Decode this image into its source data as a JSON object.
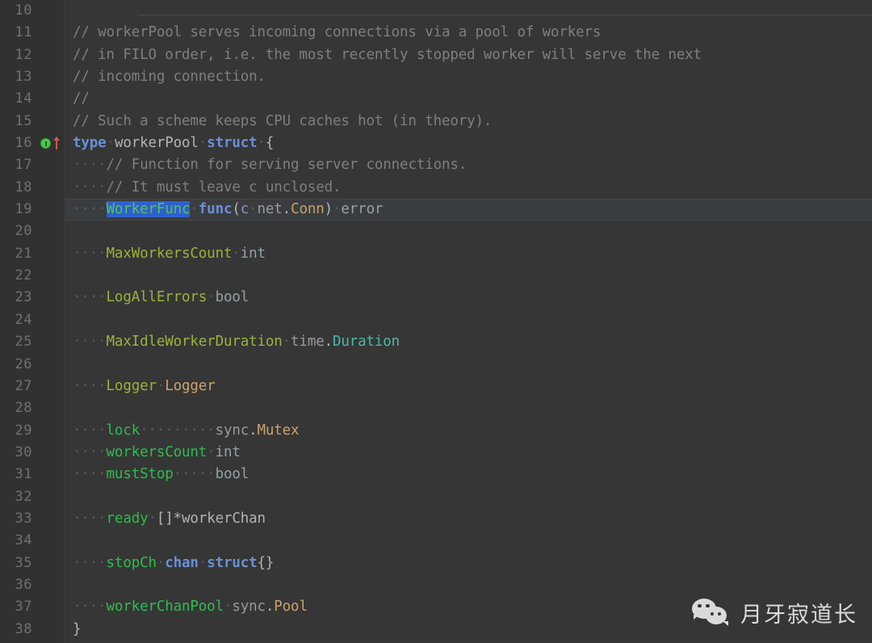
{
  "editor": {
    "language": "Go",
    "first_visible_line": 10,
    "last_visible_line": 38,
    "current_line": 19,
    "selected_text": "WorkerFunc",
    "background_color": "#363636",
    "gutter_color": "#313131",
    "current_line_color": "#3a3d3f",
    "selection_color": "#2f5fd0"
  },
  "gutter": {
    "line_numbers": [
      "10",
      "11",
      "12",
      "13",
      "14",
      "15",
      "16",
      "17",
      "18",
      "19",
      "20",
      "21",
      "22",
      "23",
      "24",
      "25",
      "26",
      "27",
      "28",
      "29",
      "30",
      "31",
      "32",
      "33",
      "34",
      "35",
      "36",
      "37",
      "38"
    ],
    "markers": [
      {
        "line": "16",
        "icons": [
          "interface-implemented-icon",
          "overridden-up-arrow-icon"
        ]
      }
    ]
  },
  "code_lines": [
    {
      "number": "10",
      "text": "",
      "tokens": []
    },
    {
      "number": "11",
      "text": "// workerPool serves incoming connections via a pool of workers",
      "tokens": [
        {
          "t": "// workerPool serves incoming connections via a pool of workers",
          "c": "comment"
        }
      ]
    },
    {
      "number": "12",
      "text": "// in FILO order, i.e. the most recently stopped worker will serve the next",
      "tokens": [
        {
          "t": "// in FILO order, i.e. the most recently stopped worker will serve the next",
          "c": "comment"
        }
      ]
    },
    {
      "number": "13",
      "text": "// incoming connection.",
      "tokens": [
        {
          "t": "// incoming connection.",
          "c": "comment"
        }
      ]
    },
    {
      "number": "14",
      "text": "//",
      "tokens": [
        {
          "t": "//",
          "c": "comment"
        }
      ]
    },
    {
      "number": "15",
      "text": "// Such a scheme keeps CPU caches hot (in theory).",
      "tokens": [
        {
          "t": "// Such a scheme keeps CPU caches hot (in theory).",
          "c": "comment"
        }
      ]
    },
    {
      "number": "16",
      "text": "type workerPool struct {",
      "tokens": [
        {
          "t": "type",
          "c": "kw"
        },
        {
          "t": " ",
          "c": "ws"
        },
        {
          "t": "workerPool",
          "c": "plain"
        },
        {
          "t": " ",
          "c": "ws"
        },
        {
          "t": "struct",
          "c": "kw"
        },
        {
          "t": " ",
          "c": "ws"
        },
        {
          "t": "{",
          "c": "plain"
        }
      ]
    },
    {
      "number": "17",
      "text": "    // Function for serving server connections.",
      "tokens": [
        {
          "t": "    ",
          "c": "ws"
        },
        {
          "t": "// Function for serving server connections.",
          "c": "comment"
        }
      ]
    },
    {
      "number": "18",
      "text": "    // It must leave c unclosed.",
      "tokens": [
        {
          "t": "    ",
          "c": "ws"
        },
        {
          "t": "// It must leave c unclosed.",
          "c": "comment"
        }
      ]
    },
    {
      "number": "19",
      "text": "    WorkerFunc func(c net.Conn) error",
      "tokens": [
        {
          "t": "    ",
          "c": "ws"
        },
        {
          "t": "WorkerFunc",
          "c": "sel"
        },
        {
          "t": " ",
          "c": "ws"
        },
        {
          "t": "func",
          "c": "kw"
        },
        {
          "t": "(",
          "c": "plain"
        },
        {
          "t": "c",
          "c": "param"
        },
        {
          "t": " ",
          "c": "ws"
        },
        {
          "t": "net",
          "c": "pkg"
        },
        {
          "t": ".",
          "c": "plain"
        },
        {
          "t": "Conn",
          "c": "type3"
        },
        {
          "t": ")",
          "c": "plain"
        },
        {
          "t": " ",
          "c": "ws"
        },
        {
          "t": "error",
          "c": "type"
        }
      ]
    },
    {
      "number": "20",
      "text": "",
      "tokens": []
    },
    {
      "number": "21",
      "text": "    MaxWorkersCount int",
      "tokens": [
        {
          "t": "    ",
          "c": "ws"
        },
        {
          "t": "MaxWorkersCount",
          "c": "field-pub"
        },
        {
          "t": " ",
          "c": "ws"
        },
        {
          "t": "int",
          "c": "type"
        }
      ]
    },
    {
      "number": "22",
      "text": "",
      "tokens": []
    },
    {
      "number": "23",
      "text": "    LogAllErrors bool",
      "tokens": [
        {
          "t": "    ",
          "c": "ws"
        },
        {
          "t": "LogAllErrors",
          "c": "field-pub"
        },
        {
          "t": " ",
          "c": "ws"
        },
        {
          "t": "bool",
          "c": "type"
        }
      ]
    },
    {
      "number": "24",
      "text": "",
      "tokens": []
    },
    {
      "number": "25",
      "text": "    MaxIdleWorkerDuration time.Duration",
      "tokens": [
        {
          "t": "    ",
          "c": "ws"
        },
        {
          "t": "MaxIdleWorkerDuration",
          "c": "field-pub"
        },
        {
          "t": " ",
          "c": "ws"
        },
        {
          "t": "time",
          "c": "pkg"
        },
        {
          "t": ".",
          "c": "plain"
        },
        {
          "t": "Duration",
          "c": "type2"
        }
      ]
    },
    {
      "number": "26",
      "text": "",
      "tokens": []
    },
    {
      "number": "27",
      "text": "    Logger Logger",
      "tokens": [
        {
          "t": "    ",
          "c": "ws"
        },
        {
          "t": "Logger",
          "c": "field-pub"
        },
        {
          "t": " ",
          "c": "ws"
        },
        {
          "t": "Logger",
          "c": "type3"
        }
      ]
    },
    {
      "number": "28",
      "text": "",
      "tokens": []
    },
    {
      "number": "29",
      "text": "    lock         sync.Mutex",
      "tokens": [
        {
          "t": "    ",
          "c": "ws"
        },
        {
          "t": "lock",
          "c": "field"
        },
        {
          "t": "         ",
          "c": "ws"
        },
        {
          "t": "sync",
          "c": "pkg"
        },
        {
          "t": ".",
          "c": "plain"
        },
        {
          "t": "Mutex",
          "c": "type3"
        }
      ]
    },
    {
      "number": "30",
      "text": "    workersCount int",
      "tokens": [
        {
          "t": "    ",
          "c": "ws"
        },
        {
          "t": "workersCount",
          "c": "field"
        },
        {
          "t": " ",
          "c": "ws"
        },
        {
          "t": "int",
          "c": "type"
        }
      ]
    },
    {
      "number": "31",
      "text": "    mustStop     bool",
      "tokens": [
        {
          "t": "    ",
          "c": "ws"
        },
        {
          "t": "mustStop",
          "c": "field"
        },
        {
          "t": "     ",
          "c": "ws"
        },
        {
          "t": "bool",
          "c": "type"
        }
      ]
    },
    {
      "number": "32",
      "text": "",
      "tokens": []
    },
    {
      "number": "33",
      "text": "    ready []*workerChan",
      "tokens": [
        {
          "t": "    ",
          "c": "ws"
        },
        {
          "t": "ready",
          "c": "field"
        },
        {
          "t": " ",
          "c": "ws"
        },
        {
          "t": "[]*workerChan",
          "c": "plain"
        }
      ]
    },
    {
      "number": "34",
      "text": "",
      "tokens": []
    },
    {
      "number": "35",
      "text": "    stopCh chan struct{}",
      "tokens": [
        {
          "t": "    ",
          "c": "ws"
        },
        {
          "t": "stopCh",
          "c": "field"
        },
        {
          "t": " ",
          "c": "ws"
        },
        {
          "t": "chan",
          "c": "kw"
        },
        {
          "t": " ",
          "c": "ws"
        },
        {
          "t": "struct",
          "c": "kw"
        },
        {
          "t": "{}",
          "c": "plain"
        }
      ]
    },
    {
      "number": "36",
      "text": "",
      "tokens": []
    },
    {
      "number": "37",
      "text": "    workerChanPool sync.Pool",
      "tokens": [
        {
          "t": "    ",
          "c": "ws"
        },
        {
          "t": "workerChanPool",
          "c": "field"
        },
        {
          "t": " ",
          "c": "ws"
        },
        {
          "t": "sync",
          "c": "pkg"
        },
        {
          "t": ".",
          "c": "plain"
        },
        {
          "t": "Pool",
          "c": "type3"
        }
      ]
    },
    {
      "number": "38",
      "text": "}",
      "tokens": [
        {
          "t": "}",
          "c": "plain"
        }
      ]
    }
  ],
  "watermark": {
    "icon": "wechat-logo-icon",
    "text": "月牙寂道长"
  }
}
